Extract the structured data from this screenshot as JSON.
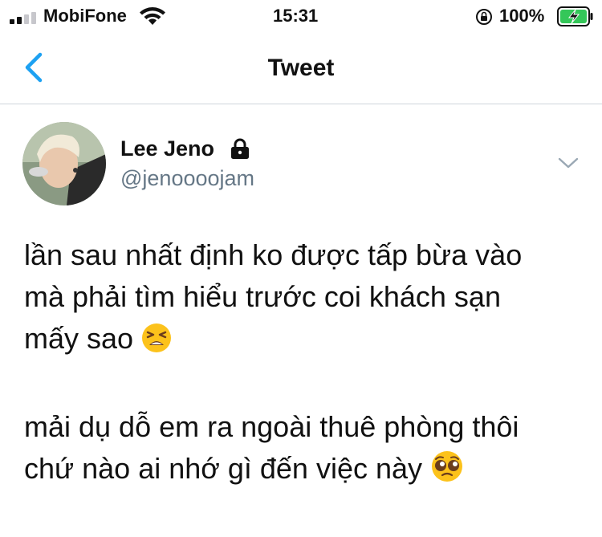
{
  "status_bar": {
    "carrier": "MobiFone",
    "time": "15:31",
    "battery_percent": "100%",
    "signal_bars_filled": 2,
    "signal_bars_total": 4
  },
  "nav": {
    "title": "Tweet",
    "back_icon": "chevron-left-icon"
  },
  "tweet": {
    "author": {
      "display_name": "Lee Jeno",
      "handle": "@jenoooojam",
      "protected": true
    },
    "lines_para1": [
      "lần sau nhất định ko được tấp bừa vào",
      "mà phải tìm hiểu trước coi khách sạn",
      "mấy sao"
    ],
    "lines_para2": [
      "mải dụ dỗ em ra ngoài thuê phòng thôi",
      "chứ nào ai nhớ gì đến việc này"
    ],
    "emoji1": "tired-face-emoji",
    "emoji2": "pleading-face-emoji"
  },
  "colors": {
    "accent": "#1da1f2",
    "secondary_text": "#657786",
    "divider": "#cfd6dc"
  }
}
